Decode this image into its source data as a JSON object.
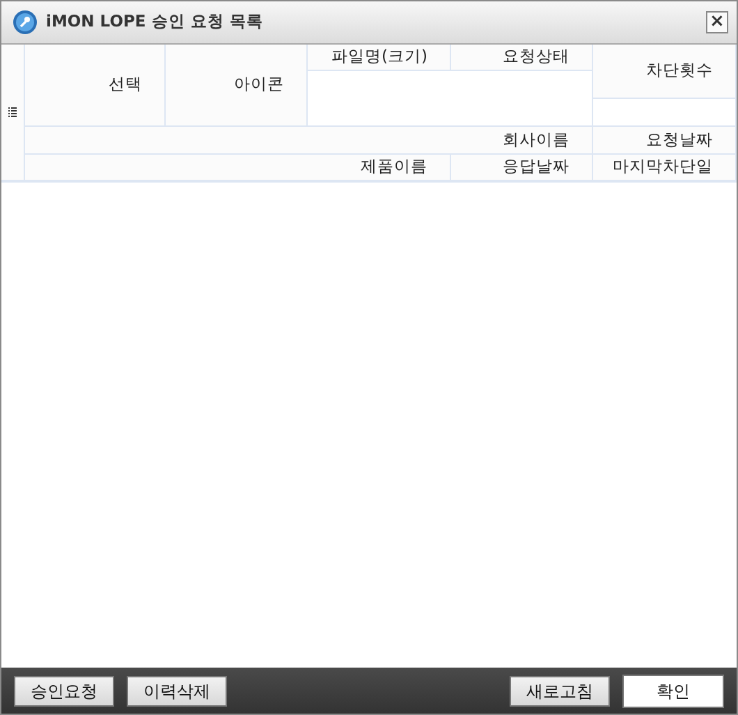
{
  "window": {
    "title": "iMON LOPE 승인 요청 목록",
    "close": "×"
  },
  "table": {
    "header_cells": [
      {
        "label": "선택"
      },
      {
        "label": "아이콘"
      },
      {
        "label": "파일명(크기)"
      },
      {
        "label": "요청상태"
      },
      {
        "label": "차단횟수"
      },
      {
        "label": "회사이름"
      },
      {
        "label": "요청날짜"
      },
      {
        "label": "제품이름"
      },
      {
        "label": "응답날짜"
      },
      {
        "label": "마지막차단일"
      }
    ]
  },
  "left_buttons": [
    {
      "label": "승인요청",
      "default": false
    },
    {
      "label": "이력삭제",
      "default": false
    }
  ],
  "right_buttons": [
    {
      "label": "새로고침",
      "default": false
    },
    {
      "label": "확인",
      "default": true
    }
  ]
}
